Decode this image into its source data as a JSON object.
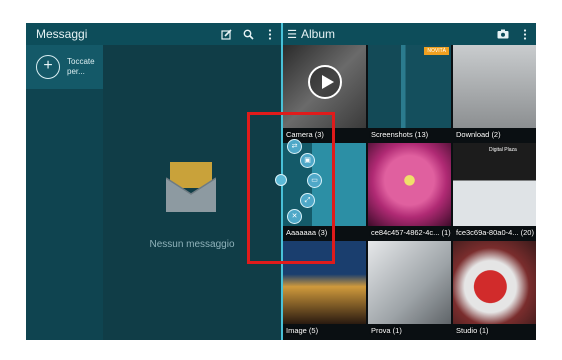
{
  "messages": {
    "title": "Messaggi",
    "compose_label": "Toccate per...",
    "empty_text": "Nessun messaggio",
    "icons": [
      "compose-icon",
      "search-icon",
      "more-icon"
    ]
  },
  "album": {
    "title": "Album",
    "items": [
      {
        "label": "Camera (3)"
      },
      {
        "label": "Screenshots (13)",
        "badge": "NOVITÀ"
      },
      {
        "label": "Download (2)"
      },
      {
        "label": "Aaaaaaa (3)"
      },
      {
        "label": "ce84c457-4862-4c... (1)"
      },
      {
        "label": "fce3c69a-80a0-4... (20)",
        "overlay_text": "Digital Plaza"
      },
      {
        "label": "Image (5)"
      },
      {
        "label": "Prova (1)"
      },
      {
        "label": "Studio (1)"
      }
    ]
  },
  "colors": {
    "header": "#0d4d5a",
    "accent": "#49c1d8",
    "highlight": "#e01b1b"
  }
}
